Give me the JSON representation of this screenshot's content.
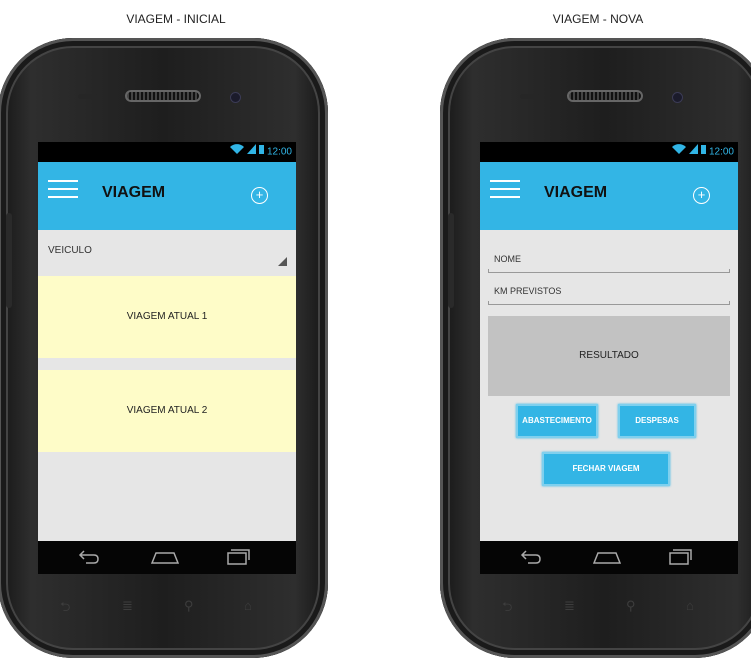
{
  "captions": {
    "left": "VIAGEM - INICIAL",
    "right": "VIAGEM - NOVA"
  },
  "status_bar": {
    "time": "12:00"
  },
  "screen1": {
    "title": "VIAGEM",
    "spinner_label": "VEICULO",
    "cards": [
      "VIAGEM ATUAL 1",
      "VIAGEM ATUAL 2"
    ]
  },
  "screen2": {
    "title": "VIAGEM",
    "fields": {
      "nome": "NOME",
      "km": "KM PREVISTOS"
    },
    "result": "RESULTADO",
    "buttons": {
      "abastecimento": "ABASTECIMENTO",
      "despesas": "DESPESAS",
      "fechar": "FECHAR VIAGEM"
    }
  },
  "icons": {
    "menu": "menu-icon",
    "add": "add-circle-icon",
    "back": "back-icon",
    "home": "home-icon",
    "recents": "recent-apps-icon"
  },
  "colors": {
    "accent": "#33b5e5",
    "card": "#fefcc8",
    "result": "#c2c2c2"
  }
}
